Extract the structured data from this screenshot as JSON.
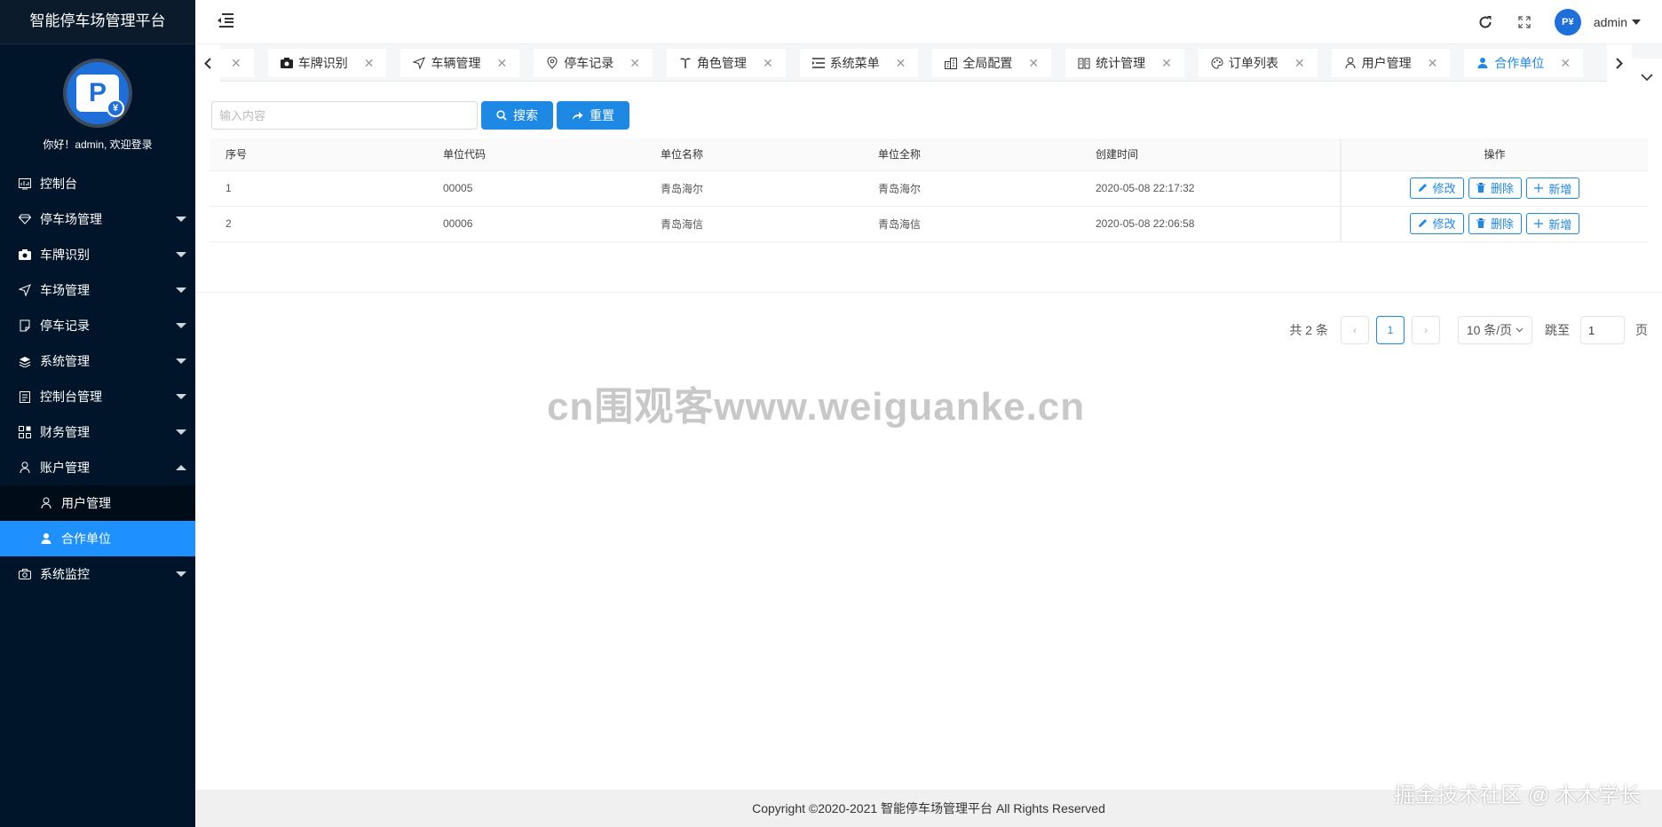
{
  "app": {
    "title": "智能停车场管理平台",
    "welcome": "你好！admin, 欢迎登录"
  },
  "menu": [
    {
      "label": "控制台",
      "icon": "dashboard-icon"
    },
    {
      "label": "停车场管理",
      "icon": "diamond-icon",
      "expandable": true
    },
    {
      "label": "车牌识别",
      "icon": "camera-icon",
      "expandable": true
    },
    {
      "label": "车场管理",
      "icon": "send-icon",
      "expandable": true
    },
    {
      "label": "停车记录",
      "icon": "note-icon",
      "expandable": true
    },
    {
      "label": "系统管理",
      "icon": "layers-icon",
      "expandable": true
    },
    {
      "label": "控制台管理",
      "icon": "clipboard-icon",
      "expandable": true
    },
    {
      "label": "财务管理",
      "icon": "grid-icon",
      "expandable": true
    },
    {
      "label": "账户管理",
      "icon": "user-icon",
      "expanded": true
    },
    {
      "label": "系统监控",
      "icon": "camera-icon",
      "expandable": true
    }
  ],
  "submenu": [
    {
      "label": "用户管理",
      "icon": "user-outline-icon"
    },
    {
      "label": "合作单位",
      "icon": "user-filled-icon",
      "active": true
    }
  ],
  "header": {
    "username": "admin"
  },
  "tabs": [
    {
      "label": "车牌识别",
      "icon": "camera-icon"
    },
    {
      "label": "车辆管理",
      "icon": "send-icon"
    },
    {
      "label": "停车记录",
      "icon": "location-icon"
    },
    {
      "label": "角色管理",
      "icon": "palm-icon"
    },
    {
      "label": "系统菜单",
      "icon": "list-icon"
    },
    {
      "label": "全局配置",
      "icon": "building-icon"
    },
    {
      "label": "统计管理",
      "icon": "book-icon"
    },
    {
      "label": "订单列表",
      "icon": "palette-icon"
    },
    {
      "label": "用户管理",
      "icon": "user-outline-icon"
    },
    {
      "label": "合作单位",
      "icon": "user-filled-icon",
      "active": true
    }
  ],
  "toolbar": {
    "search_placeholder": "输入内容",
    "search_label": "搜索",
    "reset_label": "重置"
  },
  "table": {
    "columns": [
      "序号",
      "单位代码",
      "单位名称",
      "单位全称",
      "创建时间",
      "操作"
    ],
    "rows": [
      {
        "index": "1",
        "code": "00005",
        "name": "青岛海尔",
        "fullname": "青岛海尔",
        "created": "2020-05-08 22:17:32"
      },
      {
        "index": "2",
        "code": "00006",
        "name": "青岛海信",
        "fullname": "青岛海信",
        "created": "2020-05-08 22:06:58"
      }
    ],
    "ops": {
      "edit": "修改",
      "delete": "删除",
      "add": "新增"
    }
  },
  "pagination": {
    "total": "共 2 条",
    "current_page": "1",
    "page_size": "10 条/页",
    "jump_label": "跳至",
    "jump_value": "1",
    "page_unit": "页"
  },
  "watermark": "cn围观客www.weiguanke.cn",
  "footer": "Copyright ©2020-2021 智能停车场管理平台 All Rights Reserved",
  "corner_mark": "掘金技术社区 @ 木木学长",
  "colors": {
    "sidebar": "#001529",
    "accent": "#1e88e5",
    "active_menu": "#1e90ff"
  }
}
